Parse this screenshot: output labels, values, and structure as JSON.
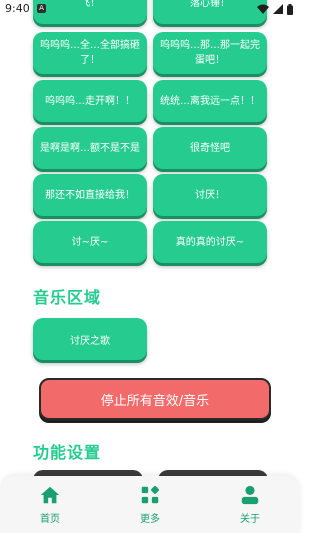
{
  "status_bar": {
    "time": "9:40",
    "notif_icon": "A"
  },
  "sound_buttons": [
    {
      "label": "飞！"
    },
    {
      "label": "落心锤！"
    },
    {
      "label": "呜呜呜…全…全部搞砸了！"
    },
    {
      "label": "呜呜呜…那…那一起完蛋吧！"
    },
    {
      "label": "呜呜呜…走开啊！！"
    },
    {
      "label": "统统…离我远一点！！"
    },
    {
      "label": "是啊是啊…额不是不是"
    },
    {
      "label": "很奇怪吧"
    },
    {
      "label": "那还不如直接给我！"
    },
    {
      "label": "讨厌！"
    },
    {
      "label": "讨~厌~"
    },
    {
      "label": "真的真的讨厌~"
    }
  ],
  "music_section": {
    "title": "音乐区域",
    "buttons": [
      {
        "label": "讨厌之歌"
      }
    ]
  },
  "stop_button": {
    "label": "停止所有音效/音乐"
  },
  "function_section": {
    "title": "功能设置"
  },
  "bottom_nav": [
    {
      "label": "首页",
      "icon": "home-icon"
    },
    {
      "label": "更多",
      "icon": "more-icon"
    },
    {
      "label": "关于",
      "icon": "about-icon"
    }
  ],
  "colors": {
    "accent": "#26cc8f",
    "stop": "#f26a6a",
    "nav_bg": "#f6f6f6"
  }
}
